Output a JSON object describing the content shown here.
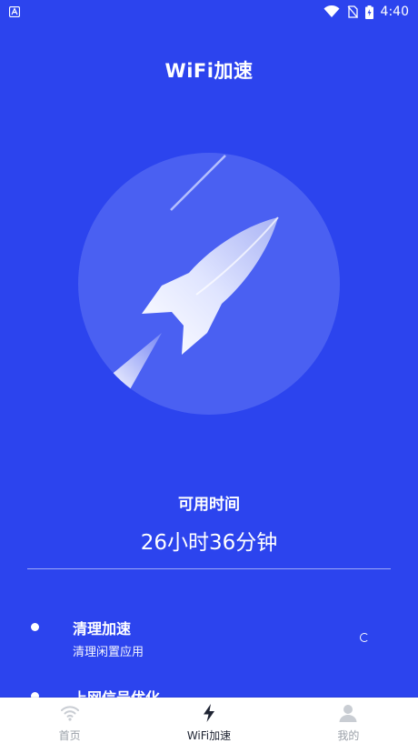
{
  "status_bar": {
    "time": "4:40",
    "icons": [
      "accessibility-icon",
      "wifi-signal-icon",
      "no-sim-icon",
      "battery-icon"
    ]
  },
  "header": {
    "title": "WiFi加速"
  },
  "hero": {
    "icon": "rocket-icon"
  },
  "summary": {
    "label": "可用时间",
    "value": "26小时36分钟"
  },
  "options": [
    {
      "title": "清理加速",
      "subtitle": "清理闲置应用",
      "status_icon": "loading-spinner-icon"
    },
    {
      "title": "上网信号优化"
    }
  ],
  "tabbar": {
    "active": "WiFi加速",
    "tabs": [
      {
        "label": "首页",
        "icon": "wifi-icon"
      },
      {
        "label": "WiFi加速",
        "icon": "lightning-icon"
      },
      {
        "label": "我的",
        "icon": "user-icon"
      }
    ]
  },
  "colors": {
    "background": "#2c44ee",
    "circle": "#4a60f2",
    "rocket": "#cfd6ff",
    "tab_active": "#1f2433",
    "tab_inactive": "#9aa0a8"
  }
}
